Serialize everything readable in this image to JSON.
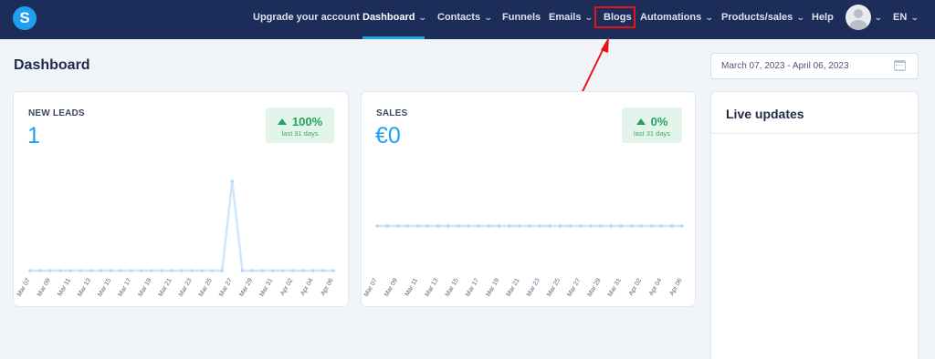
{
  "nav": {
    "logo": "S",
    "items": [
      {
        "label": "Upgrade your account"
      },
      {
        "label": "Dashboard"
      },
      {
        "label": "Contacts"
      },
      {
        "label": "Funnels"
      },
      {
        "label": "Emails"
      },
      {
        "label": "Blogs"
      },
      {
        "label": "Automations"
      },
      {
        "label": "Products/sales"
      },
      {
        "label": "Help"
      }
    ],
    "active": "Dashboard",
    "highlighted": "Blogs",
    "language": "EN"
  },
  "page": {
    "title": "Dashboard",
    "date_range": "March 07, 2023 - April 06, 2023"
  },
  "cards": {
    "leads": {
      "label": "NEW LEADS",
      "value": "1",
      "change": "100%",
      "period": "last 31 days"
    },
    "sales": {
      "label": "SALES",
      "value": "€0",
      "change": "0%",
      "period": "last 31 days"
    },
    "live": {
      "title": "Live updates"
    }
  },
  "colors": {
    "nav_bg": "#1c2d59",
    "accent": "#1ea0ee",
    "positive": "#23a45b",
    "highlight": "#e8131a",
    "chart_line": "#cfe5fb",
    "chart_point": "#b4d8f8"
  },
  "chart_data": [
    {
      "type": "line",
      "title": "NEW LEADS",
      "x": [
        "Mar 07",
        "Mar 08",
        "Mar 09",
        "Mar 10",
        "Mar 11",
        "Mar 12",
        "Mar 13",
        "Mar 14",
        "Mar 15",
        "Mar 16",
        "Mar 17",
        "Mar 18",
        "Mar 19",
        "Mar 20",
        "Mar 21",
        "Mar 22",
        "Mar 23",
        "Mar 24",
        "Mar 25",
        "Mar 26",
        "Mar 27",
        "Mar 28",
        "Mar 29",
        "Mar 30",
        "Mar 31",
        "Apr 01",
        "Apr 02",
        "Apr 03",
        "Apr 04",
        "Apr 05",
        "Apr 06"
      ],
      "tick_labels": [
        "Mar 07",
        "Mar 09",
        "Mar 11",
        "Mar 13",
        "Mar 15",
        "Mar 17",
        "Mar 19",
        "Mar 21",
        "Mar 23",
        "Mar 25",
        "Mar 27",
        "Mar 29",
        "Mar 31",
        "Apr 02",
        "Apr 04",
        "Apr 06"
      ],
      "values": [
        0,
        0,
        0,
        0,
        0,
        0,
        0,
        0,
        0,
        0,
        0,
        0,
        0,
        0,
        0,
        0,
        0,
        0,
        0,
        0,
        1,
        0,
        0,
        0,
        0,
        0,
        0,
        0,
        0,
        0,
        0
      ],
      "ylim": [
        0,
        1
      ],
      "grid": false
    },
    {
      "type": "line",
      "title": "SALES",
      "x": [
        "Mar 07",
        "Mar 08",
        "Mar 09",
        "Mar 10",
        "Mar 11",
        "Mar 12",
        "Mar 13",
        "Mar 14",
        "Mar 15",
        "Mar 16",
        "Mar 17",
        "Mar 18",
        "Mar 19",
        "Mar 20",
        "Mar 21",
        "Mar 22",
        "Mar 23",
        "Mar 24",
        "Mar 25",
        "Mar 26",
        "Mar 27",
        "Mar 28",
        "Mar 29",
        "Mar 30",
        "Mar 31",
        "Apr 01",
        "Apr 02",
        "Apr 03",
        "Apr 04",
        "Apr 05",
        "Apr 06"
      ],
      "tick_labels": [
        "Mar 07",
        "Mar 09",
        "Mar 11",
        "Mar 13",
        "Mar 15",
        "Mar 17",
        "Mar 19",
        "Mar 21",
        "Mar 23",
        "Mar 25",
        "Mar 27",
        "Mar 29",
        "Mar 31",
        "Apr 02",
        "Apr 04",
        "Apr 06"
      ],
      "values": [
        0,
        0,
        0,
        0,
        0,
        0,
        0,
        0,
        0,
        0,
        0,
        0,
        0,
        0,
        0,
        0,
        0,
        0,
        0,
        0,
        0,
        0,
        0,
        0,
        0,
        0,
        0,
        0,
        0,
        0,
        0
      ],
      "grid": false
    }
  ]
}
